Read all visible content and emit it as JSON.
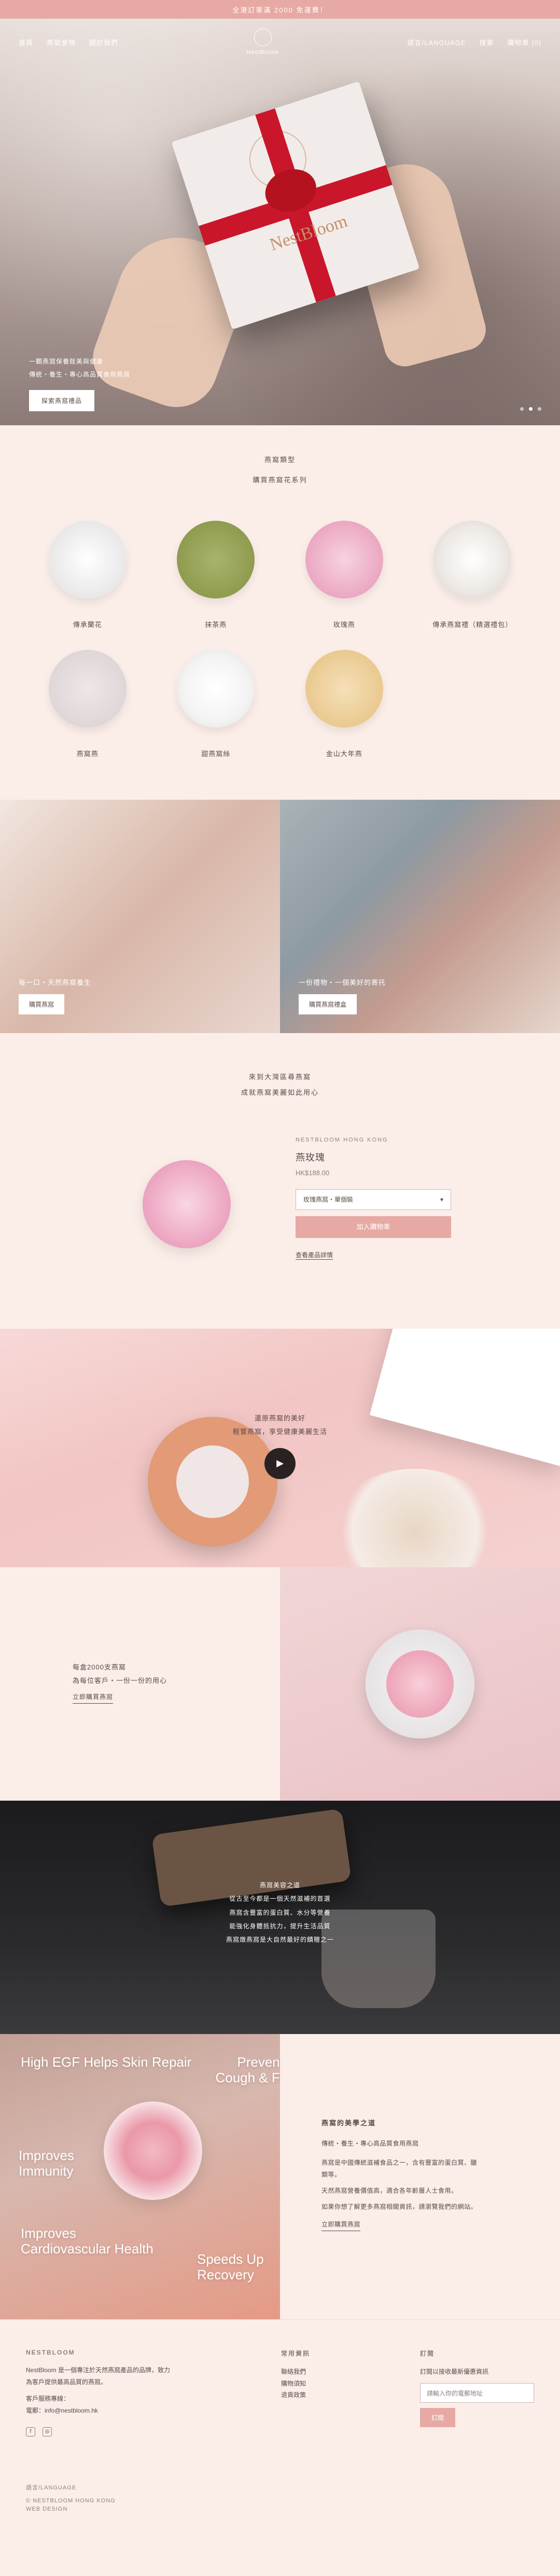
{
  "announcement": "全港訂單滿 2000 免運費！",
  "nav": {
    "left": [
      "首頁",
      "燕窩食物",
      "關於我們"
    ],
    "right": [
      "語言/LANGUAGE",
      "搜索",
      "購物車 (0)"
    ],
    "logo_text": "NestBloom"
  },
  "hero": {
    "line1": "一顆燕窩保養既美與健康",
    "line2": "傳統・養生・專心高品質食用燕窩",
    "button": "探索燕窩禮品"
  },
  "collection": {
    "title": "燕窩類型",
    "subtitle": "購買燕窩花系列",
    "items": [
      "傳承蘭花",
      "抹茶燕",
      "玫瑰燕",
      "傳承燕窩禮（精選禮包）",
      "燕窩燕",
      "甜燕窩絲",
      "金山大年燕"
    ]
  },
  "duo": {
    "left": {
      "caption": "每一口・天然燕窩養生",
      "button": "購買燕窩"
    },
    "right": {
      "caption": "一份禮物・一個美好的寄托",
      "button": "購買燕窩禮盒"
    }
  },
  "product": {
    "head1": "來到大灣區尋燕窩",
    "head2": "成就燕窩美麗如此用心",
    "brand": "NESTBLOOM HONG KONG",
    "name": "燕玫瑰",
    "price": "HK$188.00",
    "variant": "玫瑰燕窩・單個裝",
    "add": "加入購物車",
    "details": "查看產品詳情"
  },
  "video": {
    "line1": "還原燕窩的美好",
    "line2": "輕嘗燕窩，享受健康美麗生活"
  },
  "split": {
    "line1": "每盒2000支燕窩",
    "line2": "為每位客戶・一份一份的用心",
    "link": "立即購買燕窩"
  },
  "dark": {
    "l1": "燕窩美容之道",
    "l2": "從古至今都是一個天然滋補的首選",
    "l3": "燕窩含豐富的蛋白質、水分等營養",
    "l4": "能強化身體抵抗力，提升生活品質",
    "l5": "燕窩燉燕窩是大自然最好的饋贈之一"
  },
  "feature": {
    "labels": [
      "High EGF Helps Skin Repair",
      "Prevents Cough & Flu",
      "Improves Immunity",
      "Improves Cardiovascular Health",
      "Speeds Up Recovery"
    ],
    "title": "燕窩的美學之道",
    "sub": "傳統・養生・專心高品質食用燕窩",
    "p1": "燕窩是中國傳統滋補食品之一，含有豐富的蛋白質、醣類等。",
    "p2": "天然燕窩營養價值高，適合各年齡層人士食用。",
    "p3": "如果你想了解更多燕窩相關資訊，請瀏覽我們的網站。",
    "link": "立即購買燕窩"
  },
  "footer": {
    "brand": "NESTBLOOM",
    "about": "NestBloom 是一個專注於天然燕窩產品的品牌，致力為客戶提供最高品質的燕窩。",
    "contact1": "客戶服務專線：",
    "contact2": "電郵：info@nestbloom.hk",
    "col2_title": "常用資訊",
    "col2_items": [
      "聯絡我們",
      "購物須知",
      "退貨政策"
    ],
    "col3_title": "訂閱",
    "col3_text": "訂閱以接收最新優惠資訊",
    "input_placeholder": "請輸入你的電郵地址",
    "subscribe": "訂閱",
    "lang": "語言/LANGUAGE",
    "copyright": "© NESTBLOOM HONG KONG",
    "web": "WEB DESIGN"
  }
}
